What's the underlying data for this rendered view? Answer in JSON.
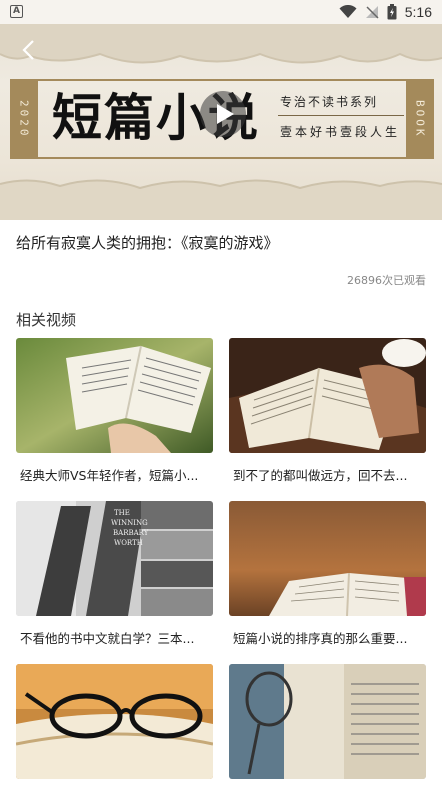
{
  "status_bar": {
    "time": "5:16",
    "notification_badge": "A"
  },
  "banner": {
    "year": "2020",
    "side_word": "BOOK",
    "title": "短篇小说",
    "subtitle_1": "专治不读书系列",
    "subtitle_2": "壹本好书壹段人生"
  },
  "video": {
    "title": "给所有寂寞人类的拥抱：《寂寞的游戏》",
    "views": "26896次已观看"
  },
  "related": {
    "heading": "相关视频",
    "items": [
      {
        "label": "经典大师VS年轻作者，短篇小..."
      },
      {
        "label": "到不了的都叫做远方，回不去..."
      },
      {
        "label": "不看他的书中文就白学？三本..."
      },
      {
        "label": "短篇小说的排序真的那么重要..."
      },
      {
        "label": ""
      },
      {
        "label": ""
      }
    ]
  },
  "colors": {
    "frame_gold": "#a48a5b",
    "banner_paper": "#ece5d8"
  }
}
